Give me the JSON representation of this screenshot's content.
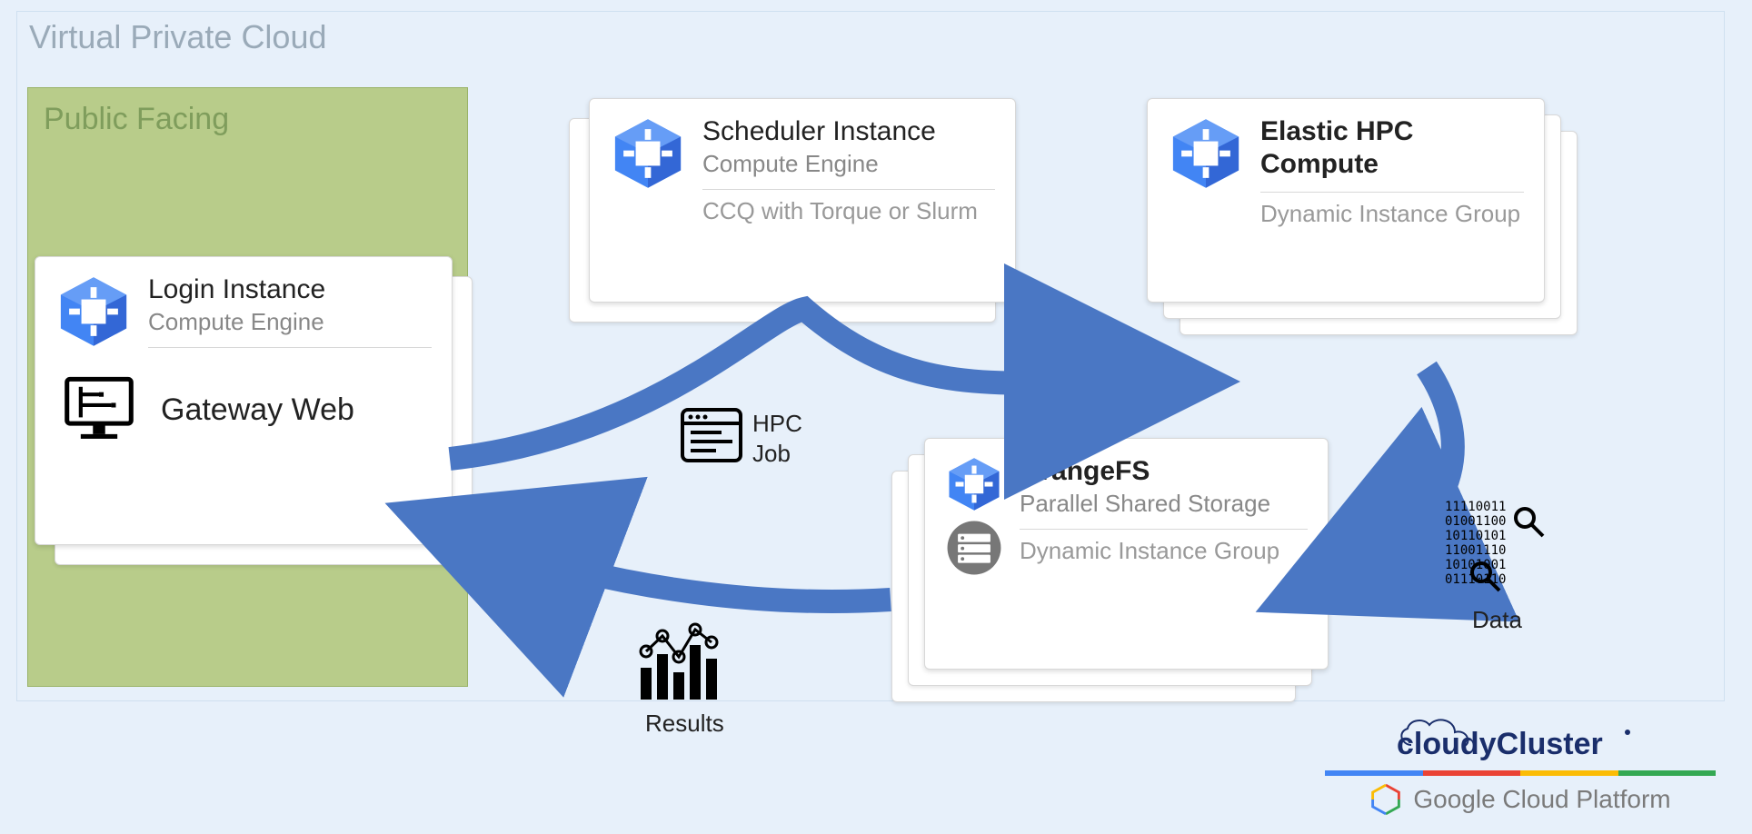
{
  "vpc": {
    "title": "Virtual Private Cloud"
  },
  "public": {
    "title": "Public Facing"
  },
  "login": {
    "title": "Login Instance",
    "subtitle": "Compute Engine",
    "gateway": "Gateway Web"
  },
  "scheduler": {
    "title": "Scheduler Instance",
    "subtitle": "Compute Engine",
    "footer": "CCQ with Torque or Slurm"
  },
  "elastic": {
    "title": "Elastic HPC Compute",
    "footer": "Dynamic Instance  Group"
  },
  "orangefs": {
    "title": "OrangeFS",
    "subtitle": "Parallel Shared Storage",
    "footer": "Dynamic Instance Group"
  },
  "labels": {
    "hpc_job": "HPC\nJob",
    "results": "Results",
    "data": "Data"
  },
  "brand": {
    "cloudy": "cloudyCluster",
    "gcp": "Google Cloud Platform"
  },
  "colors": {
    "arrow": "#4a77c4",
    "gcp_blue": "#4285F4",
    "gcp_red": "#EA4335",
    "gcp_yellow": "#FBBC05",
    "gcp_green": "#34A853"
  }
}
